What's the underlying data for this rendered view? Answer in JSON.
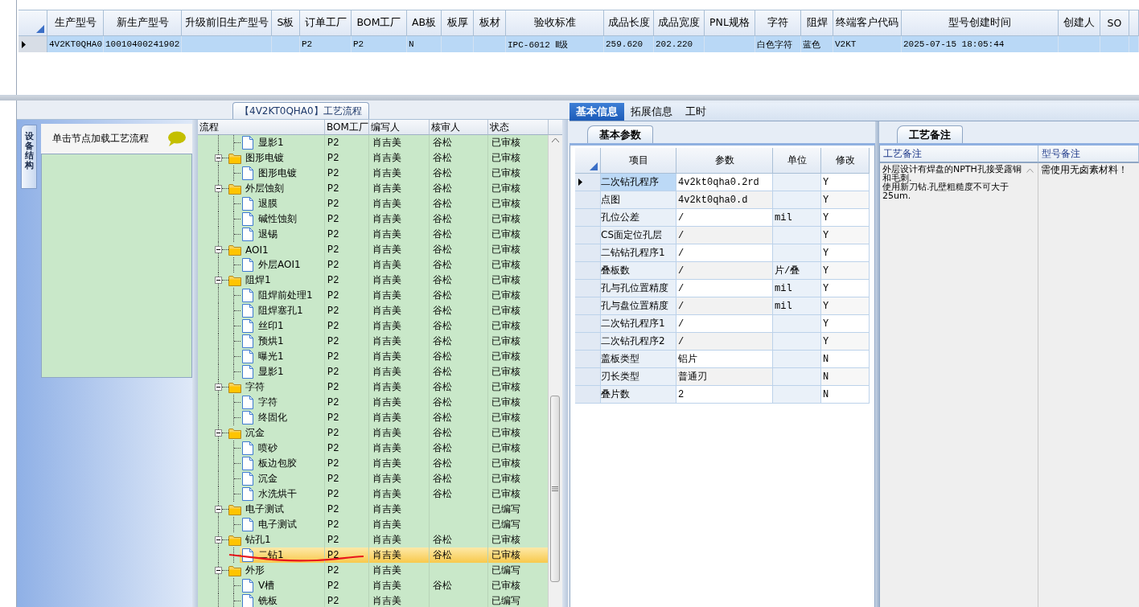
{
  "main_grid": {
    "columns": [
      "生产型号",
      "新生产型号",
      "升级前旧生产型号",
      "S板",
      "订单工厂",
      "BOM工厂",
      "AB板",
      "板厚",
      "板材",
      "验收标准",
      "成品长度",
      "成品宽度",
      "PNL规格",
      "字符",
      "阻焊",
      "终端客户代码",
      "型号创建时间",
      "创建人",
      "SO"
    ],
    "rows": [
      {
        "selected": true,
        "cells": [
          "4V2KT0QHA0",
          "10010400241902",
          null,
          null,
          "P2",
          "P2",
          "N",
          null,
          null,
          "IPC-6012 Ⅱ级",
          "259.620",
          "202.220",
          null,
          "白色字符",
          "蓝色",
          "V2KT",
          "2025-07-15 18:05:44",
          null,
          null
        ]
      }
    ]
  },
  "process_flow": {
    "title": "【4V2KT0QHA0】工艺流程",
    "side_tab": "设备结构",
    "hint": "单击节点加载工艺流程",
    "columns": [
      "流程",
      "BOM工厂",
      "编写人",
      "核审人",
      "状态"
    ],
    "tree": [
      {
        "children": [
          {
            "label": "显影1",
            "factory": "P2",
            "writer": "肖吉美",
            "reviewer": "谷松",
            "status": "已审核",
            "selected": false
          }
        ]
      },
      {
        "label": "图形电镀",
        "factory": "P2",
        "writer": "肖吉美",
        "reviewer": "谷松",
        "status": "已审核",
        "selected": false,
        "expanded": true,
        "children": [
          {
            "label": "图形电镀",
            "factory": "P2",
            "writer": "肖吉美",
            "reviewer": "谷松",
            "status": "已审核",
            "selected": false
          }
        ]
      },
      {
        "label": "外层蚀刻",
        "factory": "P2",
        "writer": "肖吉美",
        "reviewer": "谷松",
        "status": "已审核",
        "selected": false,
        "expanded": true,
        "children": [
          {
            "label": "退膜",
            "factory": "P2",
            "writer": "肖吉美",
            "reviewer": "谷松",
            "status": "已审核",
            "selected": false
          },
          {
            "label": "碱性蚀刻",
            "factory": "P2",
            "writer": "肖吉美",
            "reviewer": "谷松",
            "status": "已审核",
            "selected": false
          },
          {
            "label": "退锡",
            "factory": "P2",
            "writer": "肖吉美",
            "reviewer": "谷松",
            "status": "已审核",
            "selected": false
          }
        ]
      },
      {
        "label": "AOI1",
        "factory": "P2",
        "writer": "肖吉美",
        "reviewer": "谷松",
        "status": "已审核",
        "selected": false,
        "expanded": true,
        "children": [
          {
            "label": "外层AOI1",
            "factory": "P2",
            "writer": "肖吉美",
            "reviewer": "谷松",
            "status": "已审核",
            "selected": false
          }
        ]
      },
      {
        "label": "阻焊1",
        "factory": "P2",
        "writer": "肖吉美",
        "reviewer": "谷松",
        "status": "已审核",
        "selected": false,
        "expanded": true,
        "children": [
          {
            "label": "阻焊前处理1",
            "factory": "P2",
            "writer": "肖吉美",
            "reviewer": "谷松",
            "status": "已审核",
            "selected": false
          },
          {
            "label": "阻焊塞孔1",
            "factory": "P2",
            "writer": "肖吉美",
            "reviewer": "谷松",
            "status": "已审核",
            "selected": false
          },
          {
            "label": "丝印1",
            "factory": "P2",
            "writer": "肖吉美",
            "reviewer": "谷松",
            "status": "已审核",
            "selected": false
          },
          {
            "label": "预烘1",
            "factory": "P2",
            "writer": "肖吉美",
            "reviewer": "谷松",
            "status": "已审核",
            "selected": false
          },
          {
            "label": "曝光1",
            "factory": "P2",
            "writer": "肖吉美",
            "reviewer": "谷松",
            "status": "已审核",
            "selected": false
          },
          {
            "label": "显影1",
            "factory": "P2",
            "writer": "肖吉美",
            "reviewer": "谷松",
            "status": "已审核",
            "selected": false
          }
        ]
      },
      {
        "label": "字符",
        "factory": "P2",
        "writer": "肖吉美",
        "reviewer": "谷松",
        "status": "已审核",
        "selected": false,
        "expanded": true,
        "children": [
          {
            "label": "字符",
            "factory": "P2",
            "writer": "肖吉美",
            "reviewer": "谷松",
            "status": "已审核",
            "selected": false
          },
          {
            "label": "终固化",
            "factory": "P2",
            "writer": "肖吉美",
            "reviewer": "谷松",
            "status": "已审核",
            "selected": false
          }
        ]
      },
      {
        "label": "沉金",
        "factory": "P2",
        "writer": "肖吉美",
        "reviewer": "谷松",
        "status": "已审核",
        "selected": false,
        "expanded": true,
        "children": [
          {
            "label": "喷砂",
            "factory": "P2",
            "writer": "肖吉美",
            "reviewer": "谷松",
            "status": "已审核",
            "selected": false
          },
          {
            "label": "板边包胶",
            "factory": "P2",
            "writer": "肖吉美",
            "reviewer": "谷松",
            "status": "已审核",
            "selected": false
          },
          {
            "label": "沉金",
            "factory": "P2",
            "writer": "肖吉美",
            "reviewer": "谷松",
            "status": "已审核",
            "selected": false
          },
          {
            "label": "水洗烘干",
            "factory": "P2",
            "writer": "肖吉美",
            "reviewer": "谷松",
            "status": "已审核",
            "selected": false
          }
        ]
      },
      {
        "label": "电子测试",
        "factory": "P2",
        "writer": "肖吉美",
        "status": "已编写",
        "selected": false,
        "expanded": true,
        "children": [
          {
            "label": "电子测试",
            "factory": "P2",
            "writer": "肖吉美",
            "status": "已编写",
            "selected": false
          }
        ]
      },
      {
        "label": "钻孔1",
        "factory": "P2",
        "writer": "肖吉美",
        "reviewer": "谷松",
        "status": "已审核",
        "selected": false,
        "expanded": true,
        "children": [
          {
            "label": "二钻1",
            "factory": "P2",
            "writer": "肖吉美",
            "reviewer": "谷松",
            "status": "已审核",
            "selected": true
          }
        ]
      },
      {
        "label": "外形",
        "factory": "P2",
        "writer": "肖吉美",
        "status": "已编写",
        "selected": false,
        "expanded": true,
        "children": [
          {
            "label": "V槽",
            "factory": "P2",
            "writer": "肖吉美",
            "reviewer": "谷松",
            "status": "已审核",
            "selected": false
          },
          {
            "label": "铣板",
            "factory": "P2",
            "writer": "肖吉美",
            "status": "已编写",
            "selected": false
          }
        ]
      }
    ]
  },
  "details": {
    "tabs": [
      {
        "label": "基本信息",
        "selected": true
      },
      {
        "label": "拓展信息",
        "selected": false
      },
      {
        "label": "工时",
        "selected": false
      }
    ],
    "params": {
      "tab": "基本参数",
      "columns": [
        "项目",
        "参数",
        "单位",
        "修改"
      ],
      "rows": [
        {
          "item": "二次钻孔程序",
          "value": "4v2kt0qha0.2rd",
          "modify": "Y",
          "selected": true
        },
        {
          "item": "点图",
          "value": "4v2kt0qha0.d",
          "modify": "Y",
          "selected": false
        },
        {
          "item": "孔位公差",
          "value": "/",
          "unit": "mil",
          "modify": "Y",
          "selected": false
        },
        {
          "item": "CS面定位孔层",
          "value": "/",
          "modify": "Y",
          "selected": false
        },
        {
          "item": "二钻钻孔程序1",
          "value": "/",
          "modify": "Y",
          "selected": false
        },
        {
          "item": "叠板数",
          "value": "/",
          "unit": "片/叠",
          "modify": "Y",
          "selected": false
        },
        {
          "item": "孔与孔位置精度",
          "value": "/",
          "unit": "mil",
          "modify": "Y",
          "selected": false
        },
        {
          "item": "孔与盘位置精度",
          "value": "/",
          "unit": "mil",
          "modify": "Y",
          "selected": false
        },
        {
          "item": "二次钻孔程序1",
          "value": "/",
          "modify": "Y",
          "selected": false
        },
        {
          "item": "二次钻孔程序2",
          "value": "/",
          "modify": "Y",
          "selected": false
        },
        {
          "item": "盖板类型",
          "value": "铝片",
          "modify": "N",
          "selected": false
        },
        {
          "item": "刃长类型",
          "value": "普通刃",
          "modify": "N",
          "selected": false
        },
        {
          "item": "叠片数",
          "value": "2",
          "modify": "N",
          "selected": false
        }
      ]
    },
    "notes": {
      "tab": "工艺备注",
      "columns": [
        "工艺备注",
        "型号备注"
      ],
      "process_note": [
        "外层设计有焊盘的NPTH孔接受露铜和毛刺.",
        "使用新刀钻.孔壁粗糙度不可大于25um."
      ],
      "model_note": "需使用无卤素材料！"
    }
  }
}
